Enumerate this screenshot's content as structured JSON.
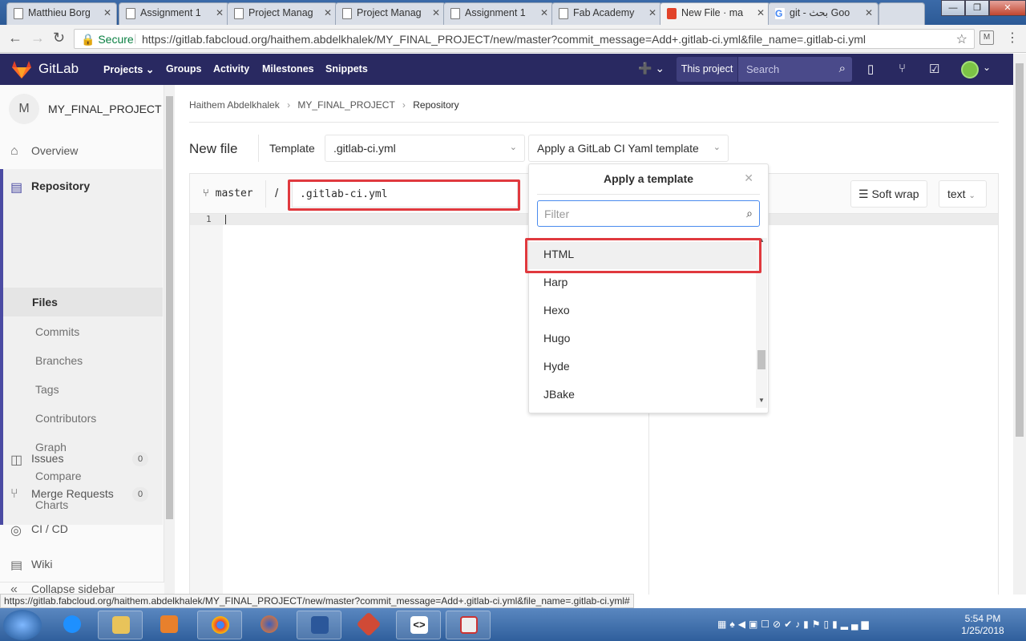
{
  "browser": {
    "tabs": [
      {
        "label": "Matthieu Borg"
      },
      {
        "label": "Assignment 1"
      },
      {
        "label": "Project Manag"
      },
      {
        "label": "Project Manag"
      },
      {
        "label": "Assignment 1"
      },
      {
        "label": "Fab Academy"
      },
      {
        "label": "New File · ma"
      },
      {
        "label": "git - بحث Goo"
      }
    ],
    "active_tab": 6,
    "secure_label": "Secure",
    "url": "https://gitlab.fabcloud.org/haithem.abdelkhalek/MY_FINAL_PROJECT/new/master?commit_message=Add+.gitlab-ci.yml&file_name=.gitlab-ci.yml",
    "status_url": "https://gitlab.fabcloud.org/haithem.abdelkhalek/MY_FINAL_PROJECT/new/master?commit_message=Add+.gitlab-ci.yml&file_name=.gitlab-ci.yml#"
  },
  "header": {
    "brand": "GitLab",
    "nav": [
      "Projects",
      "Groups",
      "Activity",
      "Milestones",
      "Snippets"
    ],
    "this_project": "This project",
    "search_placeholder": "Search"
  },
  "sidebar": {
    "avatar_letter": "M",
    "project_name": "MY_FINAL_PROJECT",
    "overview": "Overview",
    "repository": "Repository",
    "repo_items": [
      "Files",
      "Commits",
      "Branches",
      "Tags",
      "Contributors",
      "Graph",
      "Compare",
      "Charts"
    ],
    "issues": "Issues",
    "issues_count": "0",
    "merge_requests": "Merge Requests",
    "mr_count": "0",
    "cicd": "CI / CD",
    "wiki": "Wiki",
    "collapse": "Collapse sidebar"
  },
  "breadcrumb": {
    "user": "Haithem Abdelkhalek",
    "project": "MY_FINAL_PROJECT",
    "current": "Repository"
  },
  "editor": {
    "title": "New file",
    "template_label": "Template",
    "template_value": ".gitlab-ci.yml",
    "apply_template_label": "Apply a GitLab CI Yaml template",
    "branch": "master",
    "slash": "/",
    "file_name": ".gitlab-ci.yml",
    "soft_wrap": "Soft wrap",
    "mode": "text",
    "line_number": "1"
  },
  "template_menu": {
    "title": "Apply a template",
    "filter_placeholder": "Filter",
    "options": [
      "HTML",
      "Harp",
      "Hexo",
      "Hugo",
      "Hyde",
      "JBake"
    ],
    "highlighted": "HTML"
  },
  "taskbar": {
    "time": "5:54 PM",
    "date": "1/25/2018"
  },
  "colors": {
    "gitlab_header": "#292961",
    "accent": "#4b4ba3",
    "highlight_box": "#e0393e",
    "secure_green": "#0b8043"
  }
}
